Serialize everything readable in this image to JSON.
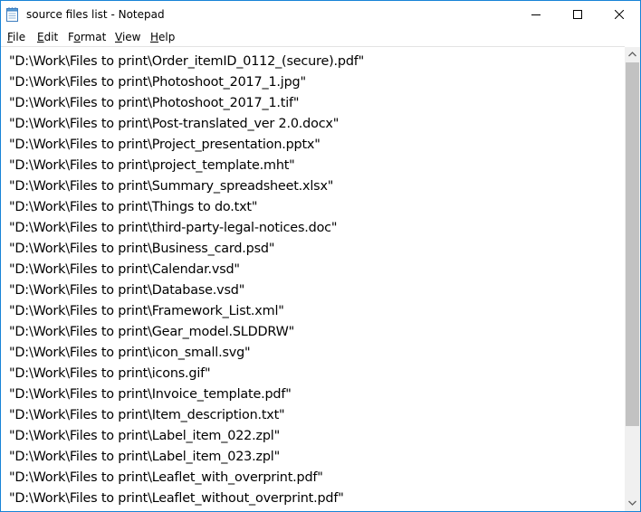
{
  "window": {
    "title": "source files list - Notepad"
  },
  "icons": {
    "app": "notepad-icon",
    "minimize": "minimize-icon",
    "maximize": "maximize-icon",
    "close": "close-icon",
    "scroll_up": "chevron-up-icon",
    "scroll_down": "chevron-down-icon"
  },
  "menu": {
    "file": {
      "accel": "F",
      "rest": "ile"
    },
    "edit": {
      "accel": "E",
      "rest": "dit"
    },
    "format": {
      "pre": "F",
      "accel": "o",
      "rest": "rmat"
    },
    "view": {
      "accel": "V",
      "rest": "iew"
    },
    "help": {
      "accel": "H",
      "rest": "elp"
    }
  },
  "document": {
    "lines": [
      "\"D:\\Work\\Files to print\\Order_itemID_0112_(secure).pdf\"",
      "\"D:\\Work\\Files to print\\Photoshoot_2017_1.jpg\"",
      "\"D:\\Work\\Files to print\\Photoshoot_2017_1.tif\"",
      "\"D:\\Work\\Files to print\\Post-translated_ver 2.0.docx\"",
      "\"D:\\Work\\Files to print\\Project_presentation.pptx\"",
      "\"D:\\Work\\Files to print\\project_template.mht\"",
      "\"D:\\Work\\Files to print\\Summary_spreadsheet.xlsx\"",
      "\"D:\\Work\\Files to print\\Things to do.txt\"",
      "\"D:\\Work\\Files to print\\third-party-legal-notices.doc\"",
      "\"D:\\Work\\Files to print\\Business_card.psd\"",
      "\"D:\\Work\\Files to print\\Calendar.vsd\"",
      "\"D:\\Work\\Files to print\\Database.vsd\"",
      "\"D:\\Work\\Files to print\\Framework_List.xml\"",
      "\"D:\\Work\\Files to print\\Gear_model.SLDDRW\"",
      "\"D:\\Work\\Files to print\\icon_small.svg\"",
      "\"D:\\Work\\Files to print\\icons.gif\"",
      "\"D:\\Work\\Files to print\\Invoice_template.pdf\"",
      "\"D:\\Work\\Files to print\\Item_description.txt\"",
      "\"D:\\Work\\Files to print\\Label_item_022.zpl\"",
      "\"D:\\Work\\Files to print\\Label_item_023.zpl\"",
      "\"D:\\Work\\Files to print\\Leaflet_with_overprint.pdf\"",
      "\"D:\\Work\\Files to print\\Leaflet_without_overprint.pdf\""
    ]
  },
  "scrollbar": {
    "thumb_fraction": 0.84,
    "position_fraction": 0.0
  },
  "colors": {
    "window_border": "#1883d7",
    "scrollbar_track": "#f0f0f0",
    "scrollbar_thumb": "#c2c2c2"
  }
}
